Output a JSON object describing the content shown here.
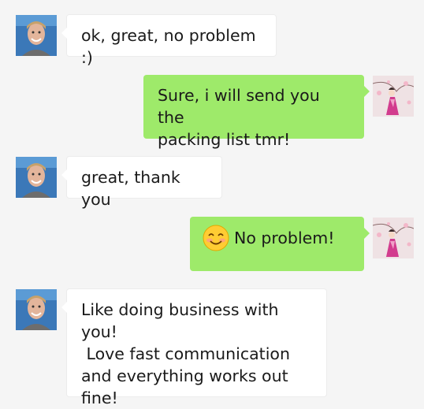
{
  "conversation": {
    "messages": [
      {
        "sender": "contact",
        "text": "ok, great, no problem :)"
      },
      {
        "sender": "me",
        "text": "Sure, i will send you the\npacking list tmr!"
      },
      {
        "sender": "contact",
        "text": "great, thank you"
      },
      {
        "sender": "me",
        "emoji": "smiling-face-emoji",
        "text": "No problem!"
      },
      {
        "sender": "contact",
        "text": "Like doing business with you!\n Love fast communication\nand everything works out\nfine!"
      }
    ]
  },
  "colors": {
    "background": "#f5f5f5",
    "incoming_bubble": "#ffffff",
    "outgoing_bubble": "#9eea6a"
  }
}
